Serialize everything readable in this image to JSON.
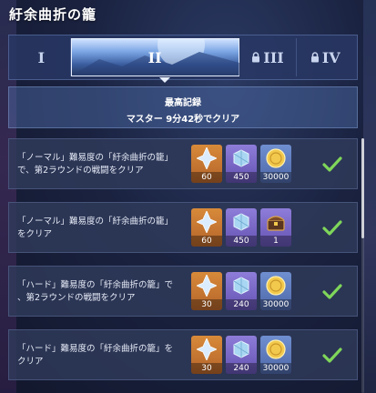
{
  "window": {
    "title": "紆余曲折の籠"
  },
  "tabs": [
    {
      "label": "I",
      "locked": false
    },
    {
      "label": "II",
      "locked": false,
      "selected": true
    },
    {
      "label": "III",
      "locked": true
    },
    {
      "label": "IV",
      "locked": true
    }
  ],
  "record": {
    "title": "最高記録",
    "value": "マスター 9分42秒でクリア"
  },
  "missions": [
    {
      "line1": "「ノーマル」難易度の「紆余曲折の籠」",
      "line2": "で、第2ラウンドの戦闘をクリア",
      "rewards": [
        {
          "icon": "crystal-icon",
          "bg": "gold",
          "count": "60"
        },
        {
          "icon": "ore-icon",
          "bg": "purple",
          "count": "450"
        },
        {
          "icon": "coin-icon",
          "bg": "blue",
          "count": "30000"
        }
      ],
      "completed": true
    },
    {
      "line1": "「ノーマル」難易度の「紆余曲折の籠」",
      "line2": "をクリア",
      "rewards": [
        {
          "icon": "crystal-icon",
          "bg": "gold",
          "count": "60"
        },
        {
          "icon": "ore-icon",
          "bg": "purple",
          "count": "450"
        },
        {
          "icon": "chest-icon",
          "bg": "purple",
          "count": "1"
        }
      ],
      "completed": true
    },
    {
      "line1": "「ハード」難易度の「紆余曲折の籠」で",
      "line2": "、第2ラウンドの戦闘をクリア",
      "rewards": [
        {
          "icon": "crystal-icon",
          "bg": "gold",
          "count": "30"
        },
        {
          "icon": "ore-icon",
          "bg": "purple",
          "count": "240"
        },
        {
          "icon": "coin-icon",
          "bg": "blue",
          "count": "30000"
        }
      ],
      "completed": true
    },
    {
      "line1": "「ハード」難易度の「紆余曲折の籠」を",
      "line2": "クリア",
      "rewards": [
        {
          "icon": "crystal-icon",
          "bg": "gold",
          "count": "30"
        },
        {
          "icon": "ore-icon",
          "bg": "purple",
          "count": "240"
        },
        {
          "icon": "coin-icon",
          "bg": "blue",
          "count": "30000"
        }
      ],
      "completed": true
    }
  ],
  "colors": {
    "check": "#7fd65a",
    "accent": "#cfe2ff"
  }
}
